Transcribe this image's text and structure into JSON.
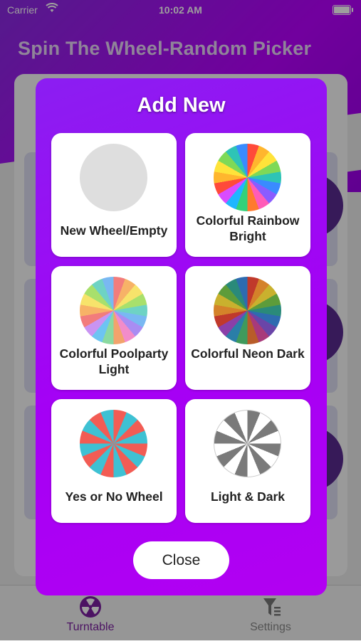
{
  "status_bar": {
    "carrier": "Carrier",
    "time": "10:02 AM"
  },
  "app": {
    "title": "Spin The Wheel-Random Picker"
  },
  "tabs": [
    {
      "label": "Turntable",
      "icon": "turntable-icon",
      "active": true,
      "color": "#7b20a0"
    },
    {
      "label": "Settings",
      "icon": "settings-icon",
      "active": false,
      "color": "#888888"
    }
  ],
  "modal": {
    "title": "Add New",
    "close_label": "Close",
    "templates": [
      {
        "name": "new-wheel-empty",
        "label": "New Wheel/Empty",
        "wheel": "empty"
      },
      {
        "name": "colorful-rainbow-bright",
        "label": "Colorful Rainbow Bright",
        "wheel": "rainbow-bright"
      },
      {
        "name": "colorful-poolparty-light",
        "label": "Colorful Poolparty Light",
        "wheel": "poolparty-light"
      },
      {
        "name": "colorful-neon-dark",
        "label": "Colorful Neon Dark",
        "wheel": "neon-dark"
      },
      {
        "name": "yes-or-no-wheel",
        "label": "Yes or No Wheel",
        "wheel": "yes-no"
      },
      {
        "name": "light-and-dark",
        "label": "Light & Dark",
        "wheel": "light-dark"
      }
    ]
  },
  "colors": {
    "accent": "#a500f5",
    "rainbow_bright": [
      "#ff4a3a",
      "#ffb62e",
      "#ffe33a",
      "#7ed957",
      "#2ec4b6",
      "#3a8bff",
      "#8a5cff",
      "#ff5cb8",
      "#ff7a2e",
      "#33d17a",
      "#1fb6ff",
      "#d94cff"
    ],
    "poolparty_light": [
      "#f27c7c",
      "#f7b267",
      "#f7e36b",
      "#a8e06c",
      "#6ed3c4",
      "#79b8f2",
      "#a98cf2",
      "#f28cc9",
      "#f2a36c",
      "#8ad9a0",
      "#6cc4f2",
      "#c994f2"
    ],
    "neon_dark": [
      "#c0392b",
      "#d4822a",
      "#c9b12e",
      "#5d9c3a",
      "#2a8a7a",
      "#2e6bb0",
      "#6a45a8",
      "#a83a7a",
      "#b85c2a",
      "#3f9a5c",
      "#2a7ea8",
      "#8a3fa8"
    ],
    "yes_no": [
      "#f25c54",
      "#3ec1d3"
    ],
    "light_dark": [
      "#7a7a7a",
      "#ffffff"
    ]
  }
}
